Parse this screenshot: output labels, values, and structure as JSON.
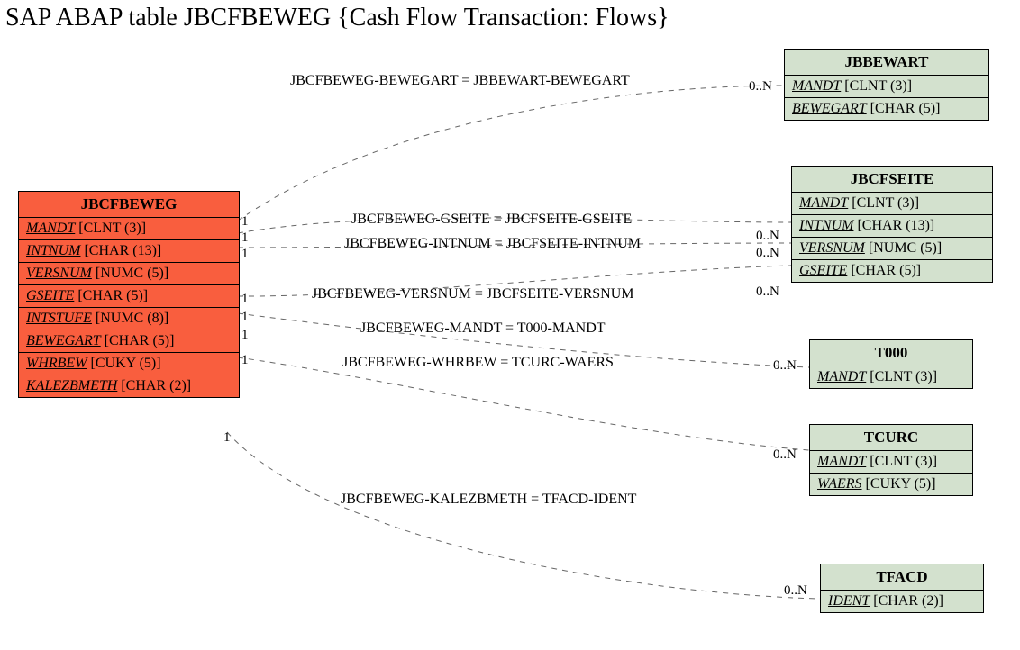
{
  "title": "SAP ABAP table JBCFBEWEG {Cash Flow Transaction: Flows}",
  "main_table": {
    "name": "JBCFBEWEG",
    "fields": [
      {
        "fname": "MANDT",
        "ftype": "[CLNT (3)]"
      },
      {
        "fname": "INTNUM",
        "ftype": "[CHAR (13)]"
      },
      {
        "fname": "VERSNUM",
        "ftype": "[NUMC (5)]"
      },
      {
        "fname": "GSEITE",
        "ftype": "[CHAR (5)]"
      },
      {
        "fname": "INTSTUFE",
        "ftype": "[NUMC (8)]"
      },
      {
        "fname": "BEWEGART",
        "ftype": "[CHAR (5)]"
      },
      {
        "fname": "WHRBEW",
        "ftype": "[CUKY (5)]"
      },
      {
        "fname": "KALEZBMETH",
        "ftype": "[CHAR (2)]"
      }
    ]
  },
  "ref_tables": {
    "jbbewart": {
      "name": "JBBEWART",
      "fields": [
        {
          "fname": "MANDT",
          "ftype": "[CLNT (3)]"
        },
        {
          "fname": "BEWEGART",
          "ftype": "[CHAR (5)]"
        }
      ]
    },
    "jbcfseite": {
      "name": "JBCFSEITE",
      "fields": [
        {
          "fname": "MANDT",
          "ftype": "[CLNT (3)]"
        },
        {
          "fname": "INTNUM",
          "ftype": "[CHAR (13)]"
        },
        {
          "fname": "VERSNUM",
          "ftype": "[NUMC (5)]"
        },
        {
          "fname": "GSEITE",
          "ftype": "[CHAR (5)]"
        }
      ]
    },
    "t000": {
      "name": "T000",
      "fields": [
        {
          "fname": "MANDT",
          "ftype": "[CLNT (3)]"
        }
      ]
    },
    "tcurc": {
      "name": "TCURC",
      "fields": [
        {
          "fname": "MANDT",
          "ftype": "[CLNT (3)]"
        },
        {
          "fname": "WAERS",
          "ftype": "[CUKY (5)]"
        }
      ]
    },
    "tfacd": {
      "name": "TFACD",
      "fields": [
        {
          "fname": "IDENT",
          "ftype": "[CHAR (2)]"
        }
      ]
    }
  },
  "relations": [
    {
      "label": "JBCFBEWEG-BEWEGART = JBBEWART-BEWEGART"
    },
    {
      "label": "JBCFBEWEG-GSEITE = JBCFSEITE-GSEITE"
    },
    {
      "label": "JBCFBEWEG-INTNUM = JBCFSEITE-INTNUM"
    },
    {
      "label": "JBCFBEWEG-VERSNUM = JBCFSEITE-VERSNUM"
    },
    {
      "label": "JBCFBEWEG-MANDT = T000-MANDT"
    },
    {
      "label": "JBCFBEWEG-WHRBEW = TCURC-WAERS"
    },
    {
      "label": "JBCFBEWEG-KALEZBMETH = TFACD-IDENT"
    }
  ],
  "cards": {
    "one": "1",
    "zn": "0..N"
  }
}
